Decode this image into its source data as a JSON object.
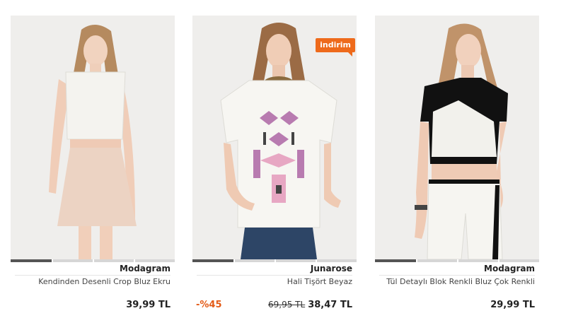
{
  "products": [
    {
      "brand": "Modagram",
      "name": "Kendinden Desenli Crop Bluz Ekru",
      "price": "39,99 TL"
    },
    {
      "brand": "Junarose",
      "name": "Hali Tişört Beyaz",
      "badge": "indirim",
      "discount": "-%45",
      "old_price": "69,95 TL",
      "price": "38,47 TL"
    },
    {
      "brand": "Modagram",
      "name": "Tül Detaylı Blok Renkli Bluz Çok Renkli",
      "price": "29,99 TL"
    }
  ],
  "colors": {
    "accent": "#ee6a1b",
    "discount_text": "#e35a16",
    "photo_bg": "#efeeec"
  }
}
